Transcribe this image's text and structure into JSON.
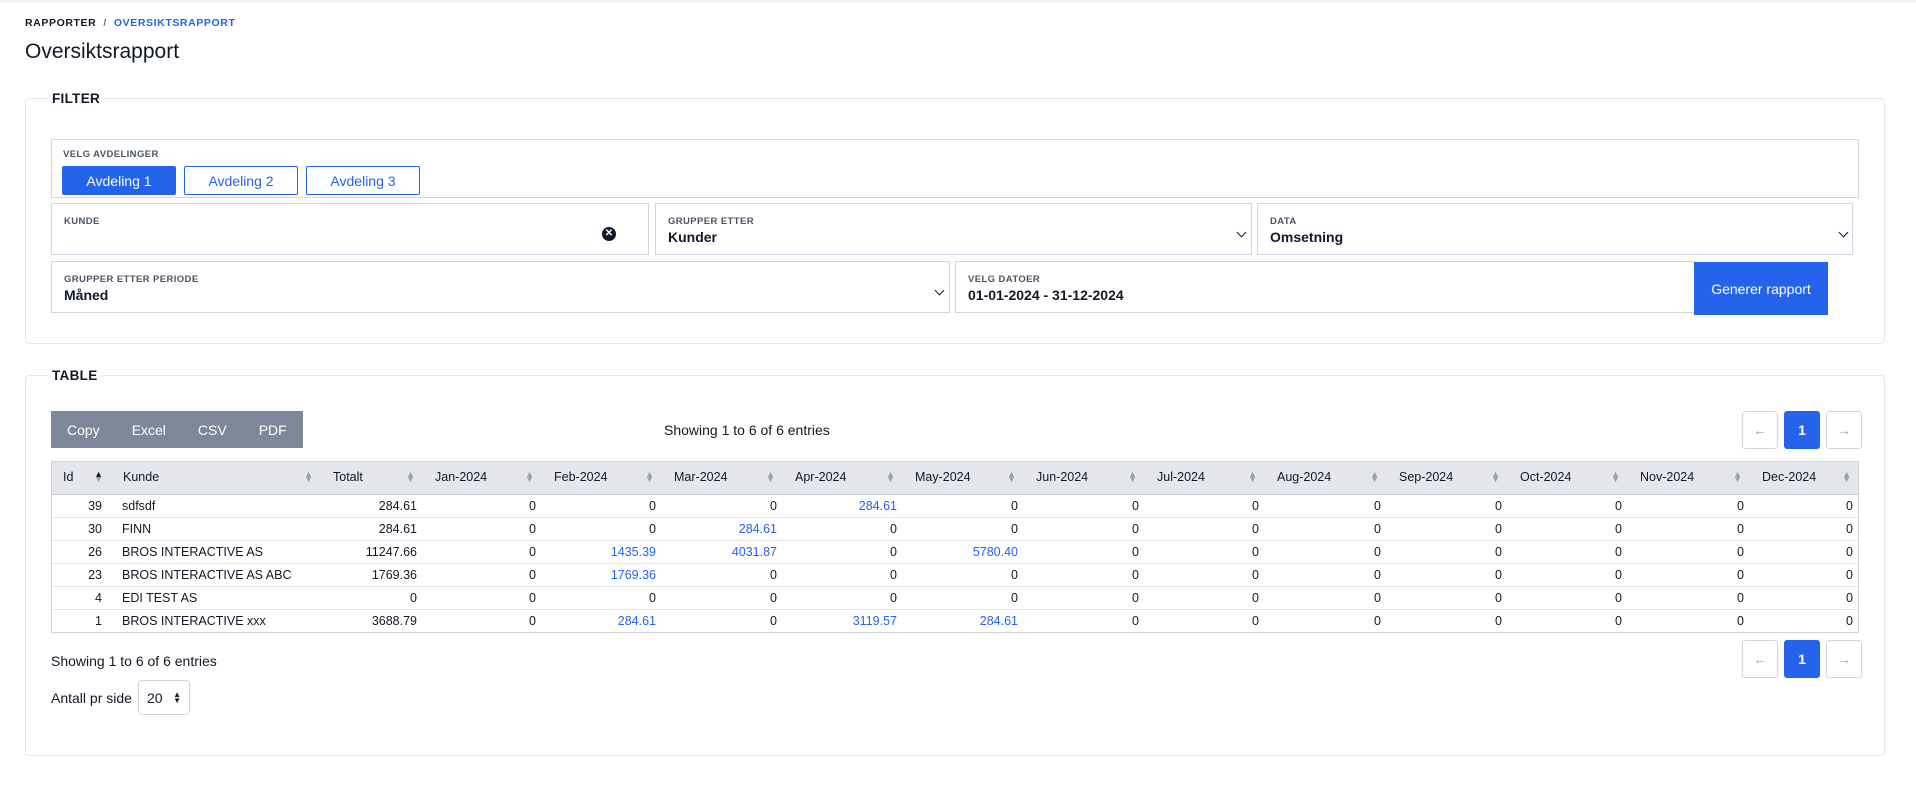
{
  "breadcrumb": {
    "root": "RAPPORTER",
    "separator": "/",
    "current": "OVERSIKTSRAPPORT"
  },
  "page_title": "Oversiktsrapport",
  "filter": {
    "legend": "FILTER",
    "departments": {
      "label": "VELG AVDELINGER",
      "buttons": [
        {
          "label": "Avdeling 1",
          "active": true
        },
        {
          "label": "Avdeling 2",
          "active": false
        },
        {
          "label": "Avdeling 3",
          "active": false
        }
      ]
    },
    "kunde": {
      "label": "KUNDE",
      "value": ""
    },
    "grupper_etter": {
      "label": "GRUPPER ETTER",
      "value": "Kunder"
    },
    "data": {
      "label": "DATA",
      "value": "Omsetning"
    },
    "grupper_periode": {
      "label": "GRUPPER ETTER PERIODE",
      "value": "Måned"
    },
    "datoer": {
      "label": "VELG DATOER",
      "value": "01-01-2024 - 31-12-2024"
    },
    "generate_label": "Generer rapport"
  },
  "table": {
    "legend": "TABLE",
    "export_buttons": [
      "Copy",
      "Excel",
      "CSV",
      "PDF"
    ],
    "info": "Showing 1 to 6 of 6 entries",
    "pager": {
      "prev": "←",
      "page": "1",
      "next": "→"
    },
    "columns": [
      "Id",
      "Kunde",
      "Totalt",
      "Jan-2024",
      "Feb-2024",
      "Mar-2024",
      "Apr-2024",
      "May-2024",
      "Jun-2024",
      "Jul-2024",
      "Aug-2024",
      "Sep-2024",
      "Oct-2024",
      "Nov-2024",
      "Dec-2024"
    ],
    "rows": [
      [
        "39",
        "sdfsdf",
        "284.61",
        "0",
        "0",
        "0",
        "284.61",
        "0",
        "0",
        "0",
        "0",
        "0",
        "0",
        "0",
        "0"
      ],
      [
        "30",
        "FINN",
        "284.61",
        "0",
        "0",
        "284.61",
        "0",
        "0",
        "0",
        "0",
        "0",
        "0",
        "0",
        "0",
        "0"
      ],
      [
        "26",
        "BROS INTERACTIVE AS",
        "11247.66",
        "0",
        "1435.39",
        "4031.87",
        "0",
        "5780.40",
        "0",
        "0",
        "0",
        "0",
        "0",
        "0",
        "0"
      ],
      [
        "23",
        "BROS INTERACTIVE AS ABC",
        "1769.36",
        "0",
        "1769.36",
        "0",
        "0",
        "0",
        "0",
        "0",
        "0",
        "0",
        "0",
        "0",
        "0"
      ],
      [
        "4",
        "EDI TEST AS",
        "0",
        "0",
        "0",
        "0",
        "0",
        "0",
        "0",
        "0",
        "0",
        "0",
        "0",
        "0",
        "0"
      ],
      [
        "1",
        "BROS INTERACTIVE xxx",
        "3688.79",
        "0",
        "284.61",
        "0",
        "3119.57",
        "284.61",
        "0",
        "0",
        "0",
        "0",
        "0",
        "0",
        "0"
      ]
    ],
    "per_page": {
      "label": "Antall pr side",
      "value": "20"
    }
  },
  "colors": {
    "accent": "#2563eb",
    "export_bg": "#7c8799",
    "header_bg": "#e5e7ed"
  }
}
